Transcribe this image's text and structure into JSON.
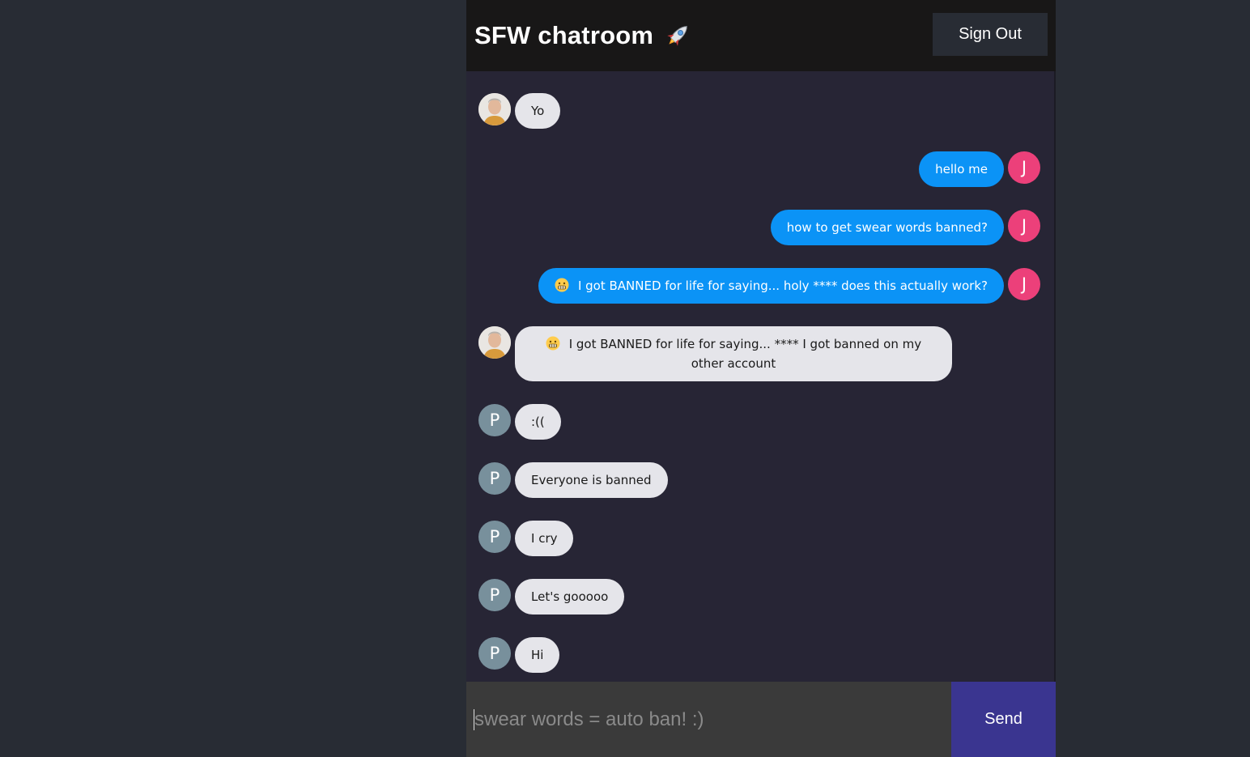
{
  "header": {
    "title": "SFW chatroom",
    "title_icon": "rocket-icon",
    "sign_out_label": "Sign Out"
  },
  "messages": [
    {
      "type": "received",
      "avatar": "photo",
      "text": "Yo"
    },
    {
      "type": "sent",
      "avatar": "J",
      "text": "hello me"
    },
    {
      "type": "sent",
      "avatar": "J",
      "text": "how to get swear words banned?"
    },
    {
      "type": "sent",
      "avatar": "J",
      "emoji": "grimacing-face-icon",
      "text": "I got BANNED for life for saying... holy **** does this actually work?"
    },
    {
      "type": "received",
      "avatar": "photo",
      "emoji": "grimacing-face-icon",
      "text": "I got BANNED for life for saying... **** I got banned on my other account"
    },
    {
      "type": "received",
      "avatar": "P",
      "text": ":(("
    },
    {
      "type": "received",
      "avatar": "P",
      "text": "Everyone is banned"
    },
    {
      "type": "received",
      "avatar": "P",
      "text": "I cry"
    },
    {
      "type": "received",
      "avatar": "P",
      "text": "Let's gooooo"
    },
    {
      "type": "received",
      "avatar": "P",
      "text": "Hi"
    }
  ],
  "composer": {
    "placeholder": "swear words = auto ban! :)",
    "value": "",
    "send_label": "Send"
  },
  "colors": {
    "page_bg": "#282c34",
    "header_bg": "#181717",
    "chat_bg": "#272535",
    "sent_bubble": "#0b93f6",
    "received_bubble": "#e5e5ea",
    "avatar_j": "#ec407a",
    "avatar_p": "#78909c",
    "send_button": "#3a3590",
    "input_bg": "#3a3a3a"
  }
}
